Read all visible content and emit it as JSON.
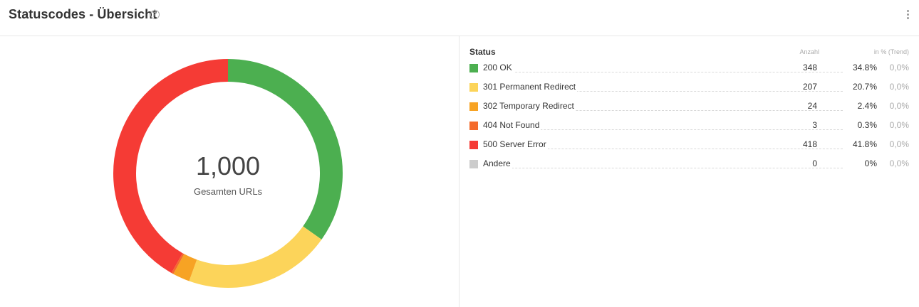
{
  "header": {
    "title": "Statuscodes - Übersicht",
    "help_icon": "?",
    "more_icon": "more-vertical-icon"
  },
  "summary": {
    "total": "1,000",
    "total_label": "Gesamten URLs"
  },
  "table": {
    "col_status": "Status",
    "col_count": "Anzahl",
    "col_pct": "in % (Trend)",
    "rows": [
      {
        "label": "200 OK",
        "count": "348",
        "pct": "34.8%",
        "trend": "0,0%",
        "color": "#4caf50"
      },
      {
        "label": "301 Permanent Redirect",
        "count": "207",
        "pct": "20.7%",
        "trend": "0,0%",
        "color": "#fcd45a"
      },
      {
        "label": "302 Temporary Redirect",
        "count": "24",
        "pct": "2.4%",
        "trend": "0,0%",
        "color": "#f7a324"
      },
      {
        "label": "404 Not Found",
        "count": "3",
        "pct": "0.3%",
        "trend": "0,0%",
        "color": "#f46b2c"
      },
      {
        "label": "500 Server Error",
        "count": "418",
        "pct": "41.8%",
        "trend": "0,0%",
        "color": "#f53b35"
      },
      {
        "label": "Andere",
        "count": "0",
        "pct": "0%",
        "trend": "0,0%",
        "color": "#cccccc"
      }
    ]
  },
  "chart_data": {
    "type": "pie",
    "variant": "donut",
    "categories": [
      "200 OK",
      "301 Permanent Redirect",
      "302 Temporary Redirect",
      "404 Not Found",
      "500 Server Error",
      "Andere"
    ],
    "values": [
      348,
      207,
      24,
      3,
      418,
      0
    ],
    "colors": [
      "#4caf50",
      "#fcd45a",
      "#f7a324",
      "#f46b2c",
      "#f53b35",
      "#cccccc"
    ],
    "center_value": "1,000",
    "center_label": "Gesamten URLs",
    "start_angle": "top, clockwise"
  }
}
